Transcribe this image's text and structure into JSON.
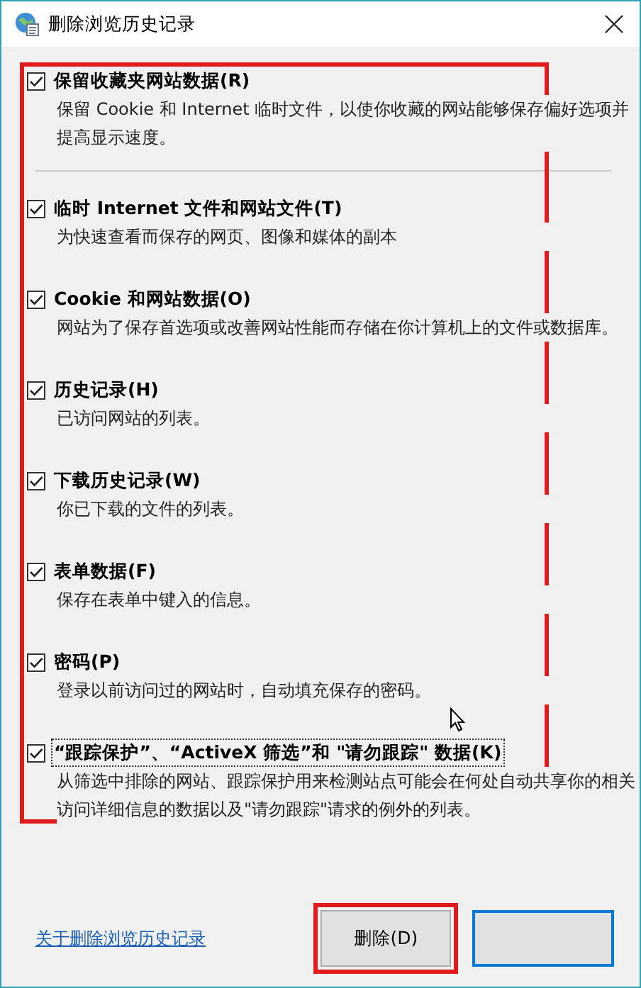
{
  "window": {
    "title": "删除浏览历史记录"
  },
  "option_groups": [
    [
      {
        "label": "保留收藏夹网站数据(R)",
        "description": "保留 Cookie 和 Internet 临时文件，以使你收藏的网站能够保存偏好选项并提高显示速度。",
        "checked": true,
        "focused": false
      }
    ],
    [
      {
        "label": "临时 Internet 文件和网站文件(T)",
        "description": "为快速查看而保存的网页、图像和媒体的副本",
        "checked": true,
        "focused": false
      },
      {
        "label": "Cookie 和网站数据(O)",
        "description": "网站为了保存首选项或改善网站性能而存储在你计算机上的文件或数据库。",
        "checked": true,
        "focused": false
      },
      {
        "label": "历史记录(H)",
        "description": "已访问网站的列表。",
        "checked": true,
        "focused": false
      },
      {
        "label": "下载历史记录(W)",
        "description": "你已下载的文件的列表。",
        "checked": true,
        "focused": false
      },
      {
        "label": "表单数据(F)",
        "description": "保存在表单中键入的信息。",
        "checked": true,
        "focused": false
      },
      {
        "label": "密码(P)",
        "description": "登录以前访问过的网站时，自动填充保存的密码。",
        "checked": true,
        "focused": false
      },
      {
        "label": "“跟踪保护”、“ActiveX 筛选”和 \"请勿跟踪\" 数据(K)",
        "description": "从筛选中排除的网站、跟踪保护用来检测站点可能会在何处自动共享你的相关访问详细信息的数据以及\"请勿跟踪\"请求的例外的列表。",
        "checked": true,
        "focused": true
      }
    ]
  ],
  "link": "关于删除浏览历史记录",
  "buttons": [
    {
      "label": "删除(D)"
    }
  ]
}
